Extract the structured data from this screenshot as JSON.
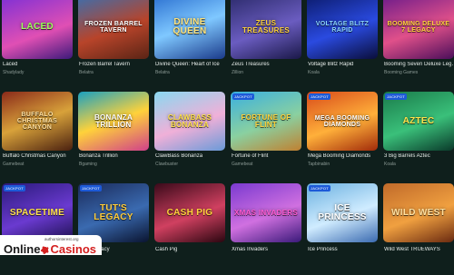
{
  "games": [
    {
      "title": "Laced",
      "provider": "Shadylady",
      "art": "Laced",
      "bg": "linear-gradient(160deg,#7b2fd6,#e04fb4 60%,#3c1a7a)",
      "fg": "#9cff5a",
      "jackpot": false
    },
    {
      "title": "Frozen Barrel Tavern",
      "provider": "Belatra",
      "art": "Frozen Barrel Tavern",
      "bg": "linear-gradient(160deg,#3a6fb0,#b8442a 55%,#5a2415)",
      "fg": "#ffffff",
      "jackpot": false
    },
    {
      "title": "Divine Queen: Heart of Ice",
      "provider": "Belatra",
      "art": "Divine Queen",
      "bg": "linear-gradient(160deg,#2a6fd0,#7fc8ff 50%,#1a3a8a)",
      "fg": "#ffe27a",
      "jackpot": false
    },
    {
      "title": "Zeus Treasures",
      "provider": "Zillion",
      "art": "Zeus Treasures",
      "bg": "linear-gradient(160deg,#2b2a6a,#6a5cc0 55%,#1a1848)",
      "fg": "#ffd23a",
      "jackpot": false
    },
    {
      "title": "Voltage Blitz Rapid",
      "provider": "Koala",
      "art": "Voltage Blitz Rapid",
      "bg": "linear-gradient(160deg,#0b1a6a,#2a4ae0 55%,#0a0e3a)",
      "fg": "#8ad4ff",
      "jackpot": false
    },
    {
      "title": "Booming Seven Deluxe Leg…",
      "provider": "Booming Games",
      "art": "Booming Deluxe 7 Legacy",
      "bg": "linear-gradient(160deg,#6a1a8a,#e0508a 55%,#4a0e5a)",
      "fg": "#ffd23a",
      "jackpot": false
    },
    {
      "title": "Buffalo Christmas Canyon",
      "provider": "Gamebeat",
      "art": "Buffalo Christmas Canyon",
      "bg": "linear-gradient(160deg,#8a2a1a,#d8a23a 50%,#4a2010)",
      "fg": "#ffe0a0",
      "jackpot": false
    },
    {
      "title": "Bonanza Trillion",
      "provider": "Bgaming",
      "art": "Bonanza Trillion",
      "bg": "linear-gradient(160deg,#1aa0c0,#ffd23a 50%,#d0408a)",
      "fg": "#ffffff",
      "jackpot": false
    },
    {
      "title": "ClawBass Bonanza",
      "provider": "Clawbuster",
      "art": "ClawBass Bonanza",
      "bg": "linear-gradient(160deg,#8ad8f0,#f0b0d8 55%,#6a9ad8)",
      "fg": "#ffe24a",
      "jackpot": false
    },
    {
      "title": "Fortune of Flint",
      "provider": "Gamebeat",
      "art": "Fortune of Flint",
      "bg": "linear-gradient(160deg,#3ab0e0,#8ad0a0 55%,#c08030)",
      "fg": "#ffd23a",
      "jackpot": true
    },
    {
      "title": "Mega Booming Diamonds",
      "provider": "Tapbinabin",
      "art": "Mega Booming Diamonds",
      "bg": "linear-gradient(160deg,#d84a1a,#ffb03a 55%,#a02a0a)",
      "fg": "#ffffff",
      "jackpot": true
    },
    {
      "title": "3 Big Barrels Aztec",
      "provider": "Koala",
      "art": "Aztec",
      "bg": "linear-gradient(160deg,#1a7a4a,#3ac07a 55%,#0a3a2a)",
      "fg": "#ffe24a",
      "jackpot": true
    },
    {
      "title": "Spacetime",
      "provider": "",
      "art": "Spacetime",
      "bg": "linear-gradient(160deg,#2a1a7a,#6a3ad0 55%,#1a0e4a)",
      "fg": "#ffe24a",
      "jackpot": true
    },
    {
      "title": "Tut's Legacy",
      "provider": "",
      "art": "Tut's Legacy",
      "bg": "linear-gradient(160deg,#1a2a5a,#3a6ab0 55%,#0a1430)",
      "fg": "#ffcc3a",
      "jackpot": true
    },
    {
      "title": "Cash Pig",
      "provider": "",
      "art": "Cash Pig",
      "bg": "linear-gradient(160deg,#3a0a1a,#d04060 55%,#2a0610)",
      "fg": "#ffd23a",
      "jackpot": false
    },
    {
      "title": "Xmas Invaders",
      "provider": "",
      "art": "Xmas Invaders",
      "bg": "linear-gradient(160deg,#7a3ad0,#d070e0 55%,#3a1a7a)",
      "fg": "#ff5ad0",
      "jackpot": false
    },
    {
      "title": "Ice Princess",
      "provider": "",
      "art": "Ice Princess",
      "bg": "linear-gradient(160deg,#6ab0e0,#d0ecff 55%,#3a6ab0)",
      "fg": "#ffffff",
      "jackpot": true
    },
    {
      "title": "Wild West TRUEWAYS",
      "provider": "",
      "art": "Wild West",
      "bg": "linear-gradient(160deg,#c06a2a,#f0a040 55%,#6a2a10)",
      "fg": "#ffe0a0",
      "jackpot": false
    }
  ],
  "jackpot_label": "JACKPOT",
  "watermark": {
    "url": "authorsinterest.org",
    "brand_start": "Online",
    "brand_end": "Casinos"
  }
}
